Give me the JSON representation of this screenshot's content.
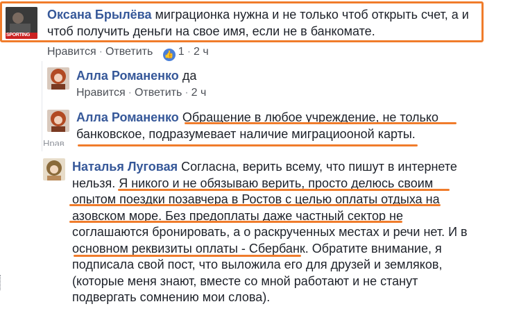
{
  "comments": [
    {
      "author": "Оксана Брылёва",
      "lines": [
        "миграционка нужна и не только чтоб открыть счет, а и",
        "чтоб получить деньги на свое имя, если не в банкомате."
      ],
      "actions": {
        "like": "Нравится",
        "reply": "Ответить",
        "like_count": "1",
        "time": "2 ч"
      },
      "avatar_text": "SPORTING"
    },
    {
      "author": "Алла Романенко",
      "lines": [
        "да"
      ],
      "actions": {
        "like": "Нравится",
        "reply": "Ответить",
        "time": "2 ч"
      }
    },
    {
      "author": "Алла Романенко",
      "lines": [
        "Обращение в любое учреждение, не только",
        "банковское, подразумевает наличие миграциооной карты."
      ]
    },
    {
      "author": "Наталья Луговая",
      "lines": [
        "Согласна, верить всему, что пишут в интернете",
        "нельзя. Я никого и не обязываю верить, просто делюсь своим",
        "опытом поездки позавчера в Ростов с целью оплаты отдыха на",
        "азовском море. Без предоплаты даже частный сектор не",
        "соглашаются бронировать, а о раскрученных местах и речи нет. И в",
        "основном реквизиты оплаты - Сбербанк. Обратите внимание, я",
        "подписала свой пост, что выложила его для друзей и земляков,",
        "(которые меня знают, вместе со мной работают и не станут",
        "подвергать сомнению мои слова)."
      ]
    }
  ],
  "fragment_text": "Нрав",
  "accent_color": "#f07c2b",
  "name_color": "#365899",
  "like_icon": "thumbs-up-icon"
}
